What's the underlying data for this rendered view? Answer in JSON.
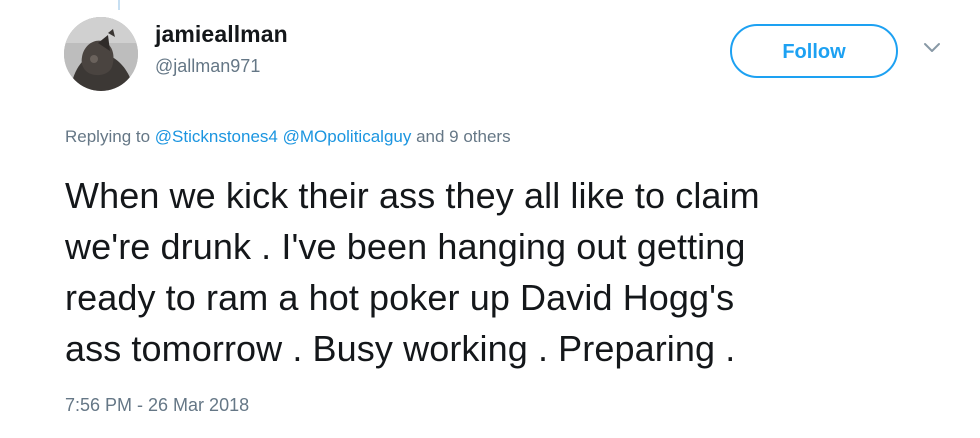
{
  "user": {
    "display_name": "jamieallman",
    "handle": "@jallman971",
    "avatar_icon": "profile-photo"
  },
  "actions": {
    "follow_label": "Follow",
    "menu_icon": "chevron-down-icon"
  },
  "reply": {
    "prefix": "Replying to ",
    "mention_1": "@Sticknstones4",
    "separator": " ",
    "mention_2": "@MOpoliticalguy",
    "suffix": " and 9 others"
  },
  "tweet": {
    "line_1": "When we kick their ass they all like to claim",
    "line_2": "we're drunk . I've been hanging out getting",
    "line_3": "ready to ram a hot poker up David Hogg's",
    "line_4": "ass tomorrow . Busy working . Preparing .",
    "timestamp": "7:56 PM - 26 Mar 2018"
  },
  "colors": {
    "accent": "#1da1f2",
    "link": "#1b95e0",
    "secondary_text": "#657786",
    "primary_text": "#14171a"
  }
}
